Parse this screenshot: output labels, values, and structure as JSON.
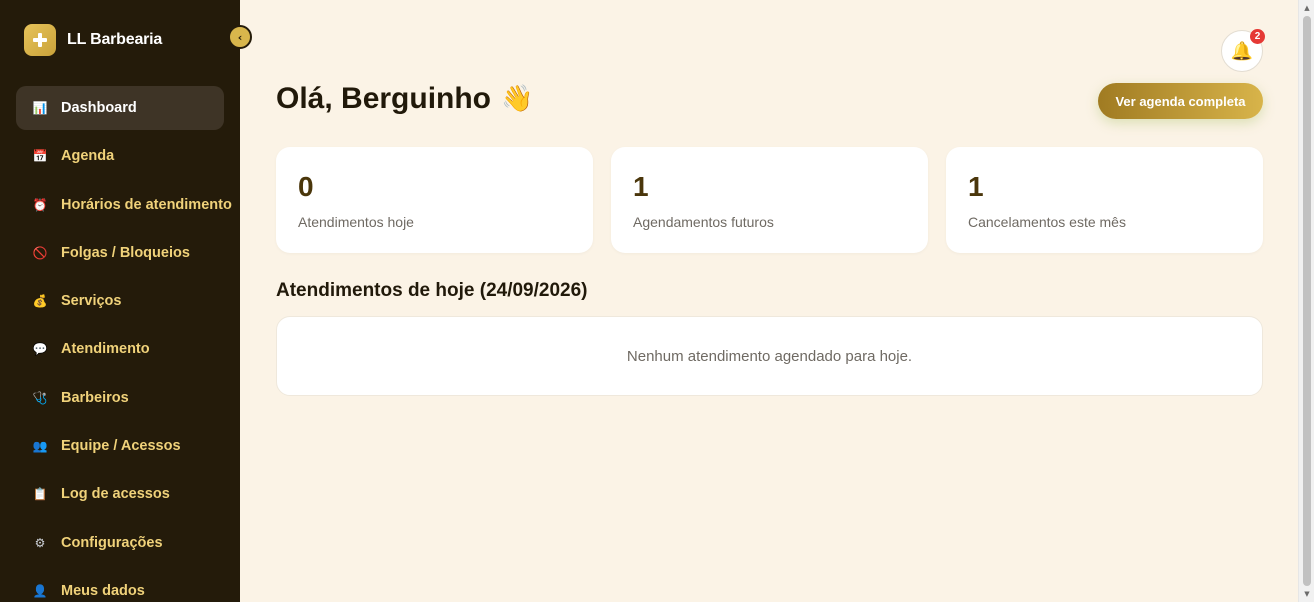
{
  "brand": {
    "name": "LL Barbearia"
  },
  "sidebar": {
    "collapse_glyph": "‹",
    "items": [
      {
        "label": "Dashboard",
        "icon": "bar-chart-icon",
        "glyph": "📊",
        "active": true
      },
      {
        "label": "Agenda",
        "icon": "calendar-icon",
        "glyph": "📅"
      },
      {
        "label": "Horários de atendimento",
        "icon": "alarm-clock-icon",
        "glyph": "⏰"
      },
      {
        "label": "Folgas / Bloqueios",
        "icon": "prohibited-icon",
        "glyph": "🚫"
      },
      {
        "label": "Serviços",
        "icon": "money-bag-icon",
        "glyph": "💰"
      },
      {
        "label": "Atendimento",
        "icon": "speech-bubble-icon",
        "glyph": "💬"
      },
      {
        "label": "Barbeiros",
        "icon": "stethoscope-icon",
        "glyph": "🩺"
      },
      {
        "label": "Equipe / Acessos",
        "icon": "people-icon",
        "glyph": "👥"
      },
      {
        "label": "Log de acessos",
        "icon": "clipboard-icon",
        "glyph": "📋"
      },
      {
        "label": "Configurações",
        "icon": "gear-icon",
        "glyph": "⚙"
      },
      {
        "label": "Meus dados",
        "icon": "person-icon",
        "glyph": "👤"
      }
    ]
  },
  "header": {
    "notifications": {
      "count": "2",
      "icon": "bell-icon",
      "glyph": "🔔"
    },
    "greeting": "Olá, Berguinho",
    "greeting_emoji": "👋",
    "agenda_button": "Ver agenda completa"
  },
  "stats": [
    {
      "value": "0",
      "label": "Atendimentos hoje"
    },
    {
      "value": "1",
      "label": "Agendamentos futuros"
    },
    {
      "value": "1",
      "label": "Cancelamentos este mês"
    }
  ],
  "today": {
    "title": "Atendimentos de hoje (24/09/2026)",
    "empty_text": "Nenhum atendimento agendado para hoje."
  },
  "colors": {
    "sidebar_bg": "#241b0a",
    "accent_gold": "#d8b44a",
    "nav_text": "#f0d27a",
    "page_bg": "#fbf3e6",
    "badge_red": "#e53935"
  }
}
